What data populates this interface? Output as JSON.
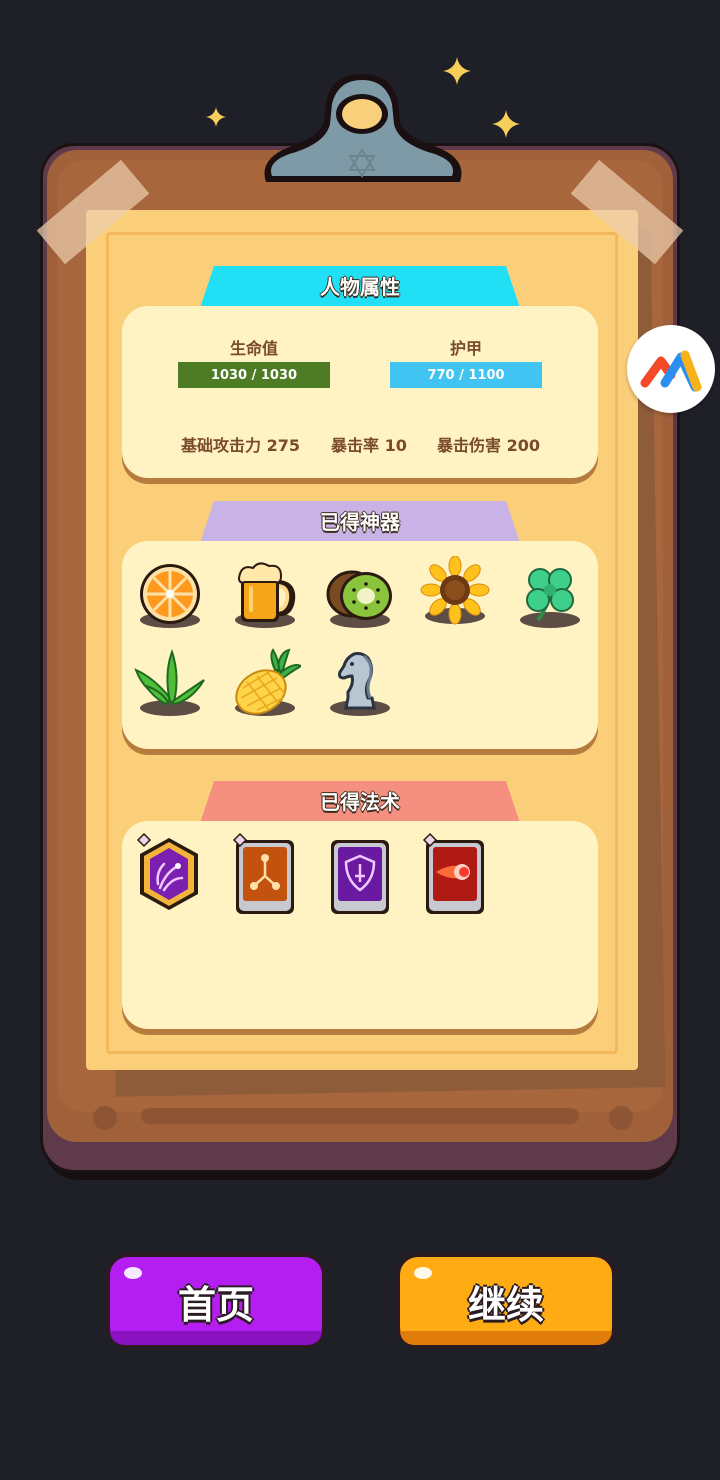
{
  "stats_section": {
    "title": "人物属性",
    "hp_label": "生命值",
    "hp_value": "1030 / 1030",
    "hp_fraction": 1.0,
    "armor_label": "护甲",
    "armor_value": "770 / 1100",
    "armor_fraction": 1.0,
    "base_attack": "基础攻击力 275",
    "crit_rate": "暴击率 10",
    "crit_damage": "暴击伤害 200"
  },
  "artifacts_section": {
    "title": "已得神器",
    "items": [
      "orange-slice-icon",
      "beer-mug-icon",
      "kiwi-icon",
      "sunflower-icon",
      "four-leaf-clover-icon",
      "aloe-plant-icon",
      "pineapple-icon",
      "chess-knight-icon"
    ]
  },
  "spells_section": {
    "title": "已得法术",
    "items": [
      "spirit-wisp-spell-icon",
      "chain-split-spell-icon",
      "shield-sword-spell-icon",
      "fireball-spell-icon"
    ]
  },
  "buttons": {
    "home": "首页",
    "continue": "继续"
  },
  "colors": {
    "hp_bar": "#4e7c25",
    "armor_bar": "#41c4f2",
    "stats_tab": "#21e0f5",
    "artifacts_tab": "#c9b2e6",
    "spells_tab": "#f59080",
    "home_button": "#b51ef0",
    "continue_button": "#ffab14"
  }
}
